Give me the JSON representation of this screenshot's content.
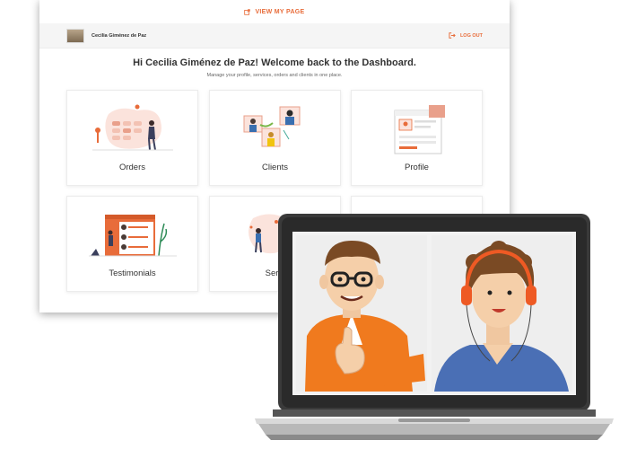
{
  "view_page": {
    "label": "VIEW MY PAGE"
  },
  "header": {
    "user_name": "Cecilia Giménez de Paz",
    "logout_label": "LOG OUT"
  },
  "welcome": {
    "title": "Hi Cecilia Giménez de Paz! Welcome back to the Dashboard.",
    "subtitle": "Manage your profile, services, orders and clients in one place."
  },
  "cards": [
    {
      "label": "Orders"
    },
    {
      "label": "Clients"
    },
    {
      "label": "Profile"
    },
    {
      "label": "Testimonials"
    },
    {
      "label": "Servi"
    },
    {
      "label": ""
    }
  ],
  "colors": {
    "accent": "#e86c3a",
    "dark": "#333333",
    "laptop_frame": "#3a3a3a"
  },
  "icons": [
    "external-link-icon",
    "logout-icon"
  ]
}
